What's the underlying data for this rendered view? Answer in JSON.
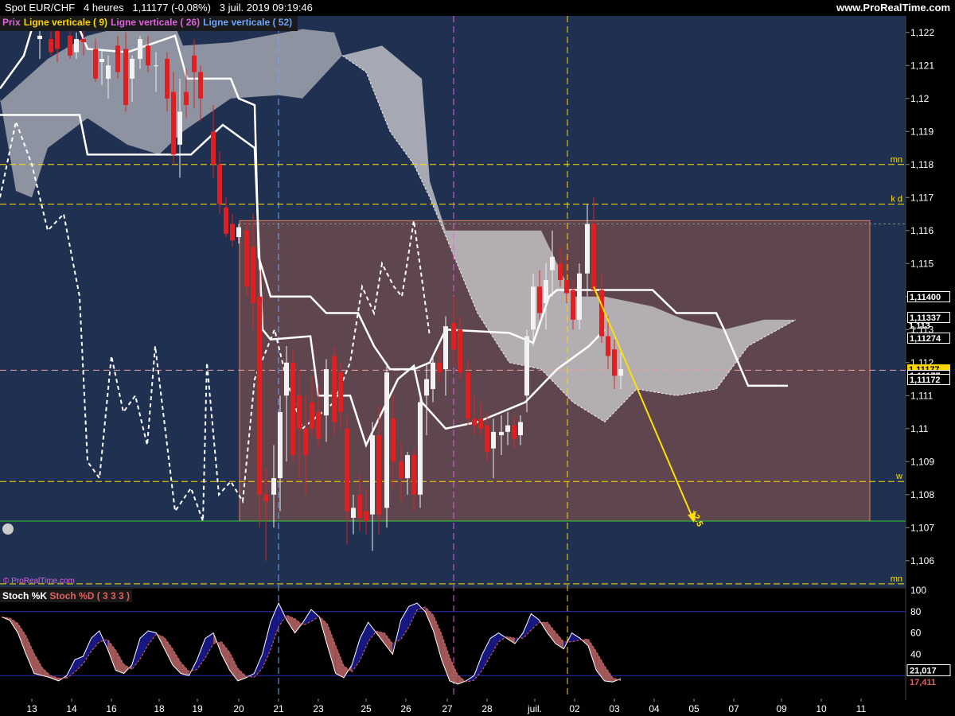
{
  "header": {
    "symbol": "Spot EUR/CHF",
    "timeframe": "4 heures",
    "price": "1,11177 (-0,08%)",
    "datetime": "3 juil. 2019 09:19:46",
    "site": "www.ProRealTime.com"
  },
  "legend": [
    {
      "label": "Prix",
      "color": "#e060e0"
    },
    {
      "label": "Ligne verticale",
      "param": "9",
      "color": "#ffd700"
    },
    {
      "label": "Ligne verticale",
      "param": "26",
      "color": "#e060e0"
    },
    {
      "label": "Ligne verticale",
      "param": "52",
      "color": "#6ca6ff"
    }
  ],
  "watermark": "© ProRealTime.com",
  "colors": {
    "panel_bg": "#1f3050",
    "sub_bg": "#000000",
    "bull": "#f2f2f2",
    "bear": "#e02020",
    "level_yellow": "#ffe000",
    "green_line": "#33cc33",
    "box_fill": "#6b4a4e",
    "box_border": "#e08060",
    "arrow": "#ffe000"
  },
  "chart_data": {
    "type": "candlestick",
    "title": "Spot EUR/CHF",
    "ylim": [
      1.1052,
      1.1225
    ],
    "y_ticks": [
      "1,122",
      "1,121",
      "1,12",
      "1,119",
      "1,118",
      "1,117",
      "1,116",
      "1,115",
      "1,114",
      "1,113",
      "1,112",
      "1,111",
      "1,11",
      "1,109",
      "1,108",
      "1,107",
      "1,106"
    ],
    "x_ticks": [
      "13",
      "14",
      "16",
      "18",
      "19",
      "20",
      "21",
      "23",
      "25",
      "26",
      "27",
      "28",
      "juil.",
      "02",
      "03",
      "04",
      "05",
      "07",
      "09",
      "10",
      "11"
    ],
    "levels": [
      {
        "label": "mn",
        "value": 1.118
      },
      {
        "label": "k d",
        "value": 1.1168
      },
      {
        "label": "w",
        "value": 1.1084
      },
      {
        "label": "mn",
        "value": 1.1053
      }
    ],
    "support_level": 1.1072,
    "last_price_line": 1.11177,
    "price_labels": [
      {
        "text": "1,11400",
        "value": 1.114,
        "style": "white"
      },
      {
        "text": "1,11337",
        "value": 1.11337,
        "style": "white"
      },
      {
        "text": "1,113",
        "value": 1.1131,
        "style": "plain"
      },
      {
        "text": "1,11274",
        "value": 1.11274,
        "style": "white"
      },
      {
        "text": "1,11177",
        "value": 1.11177,
        "style": "yellow"
      },
      {
        "text": "1,11177",
        "value": 1.1116,
        "style": "white"
      },
      {
        "text": "1,11172",
        "value": 1.1115,
        "style": "white"
      }
    ],
    "arrow_label": "+2.5",
    "stochastic": {
      "k_label": "Stoch %K",
      "d_label": "Stoch %D ( 3 3 3 )",
      "ylim": [
        0,
        100
      ],
      "y_ticks": [
        "100",
        "80",
        "60",
        "40"
      ],
      "bands": [
        80,
        20
      ],
      "k_last": "21,017",
      "d_last": "17,411",
      "k": [
        75,
        72,
        60,
        40,
        22,
        20,
        18,
        15,
        20,
        35,
        38,
        55,
        62,
        45,
        25,
        22,
        30,
        55,
        62,
        60,
        45,
        30,
        22,
        20,
        35,
        55,
        60,
        40,
        25,
        15,
        18,
        22,
        40,
        70,
        88,
        72,
        60,
        70,
        82,
        75,
        48,
        22,
        18,
        30,
        55,
        70,
        60,
        50,
        40,
        72,
        85,
        88,
        80,
        62,
        35,
        15,
        12,
        15,
        20,
        40,
        55,
        60,
        55,
        50,
        60,
        78,
        72,
        60,
        50,
        45,
        60,
        55,
        48,
        25,
        15,
        14,
        17
      ]
    }
  }
}
